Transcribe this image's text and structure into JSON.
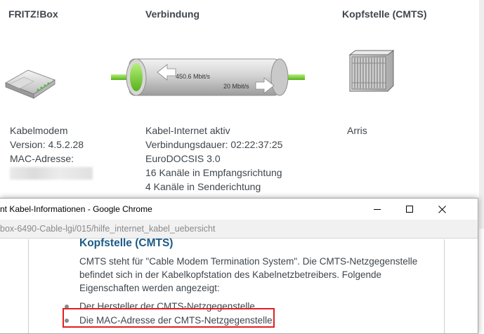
{
  "columns": {
    "fritzbox": {
      "title": "FRITZ!Box",
      "lines": [
        "Kabelmodem",
        "Version: 4.5.2.28",
        "MAC-Adresse:"
      ]
    },
    "connection": {
      "title": "Verbindung",
      "downstream": "450.6 Mbit/s",
      "upstream": "20 Mbit/s",
      "lines": [
        "Kabel-Internet aktiv",
        "Verbindungsdauer: 02:22:37:25",
        "EuroDOCSIS 3.0",
        "16 Kanäle in Empfangsrichtung",
        "4 Kanäle in Senderichtung"
      ]
    },
    "cmts": {
      "title": "Kopfstelle (CMTS)",
      "lines": [
        "Arris"
      ]
    }
  },
  "popup": {
    "window_title": "nt Kabel-Informationen - Google Chrome",
    "url": "box-6490-Cable-lgi/015/hilfe_internet_kabel_uebersicht",
    "heading": "Kopfstelle (CMTS)",
    "paragraph": "CMTS steht für \"Cable Modem Termination System\". Die CMTS-Netzgegenstelle befindet sich in der Kabelkopfstation des Kabelnetzbetreibers. Folgende Eigenschaften werden angezeigt:",
    "list": [
      "Der Hersteller der CMTS-Netzgegenstelle.",
      "Die MAC-Adresse der CMTS-Netzgegenstelle."
    ]
  },
  "colors": {
    "heading_blue": "#1a5a87",
    "highlight_red": "#e0201f",
    "pipe_green": "#7dd13a"
  }
}
